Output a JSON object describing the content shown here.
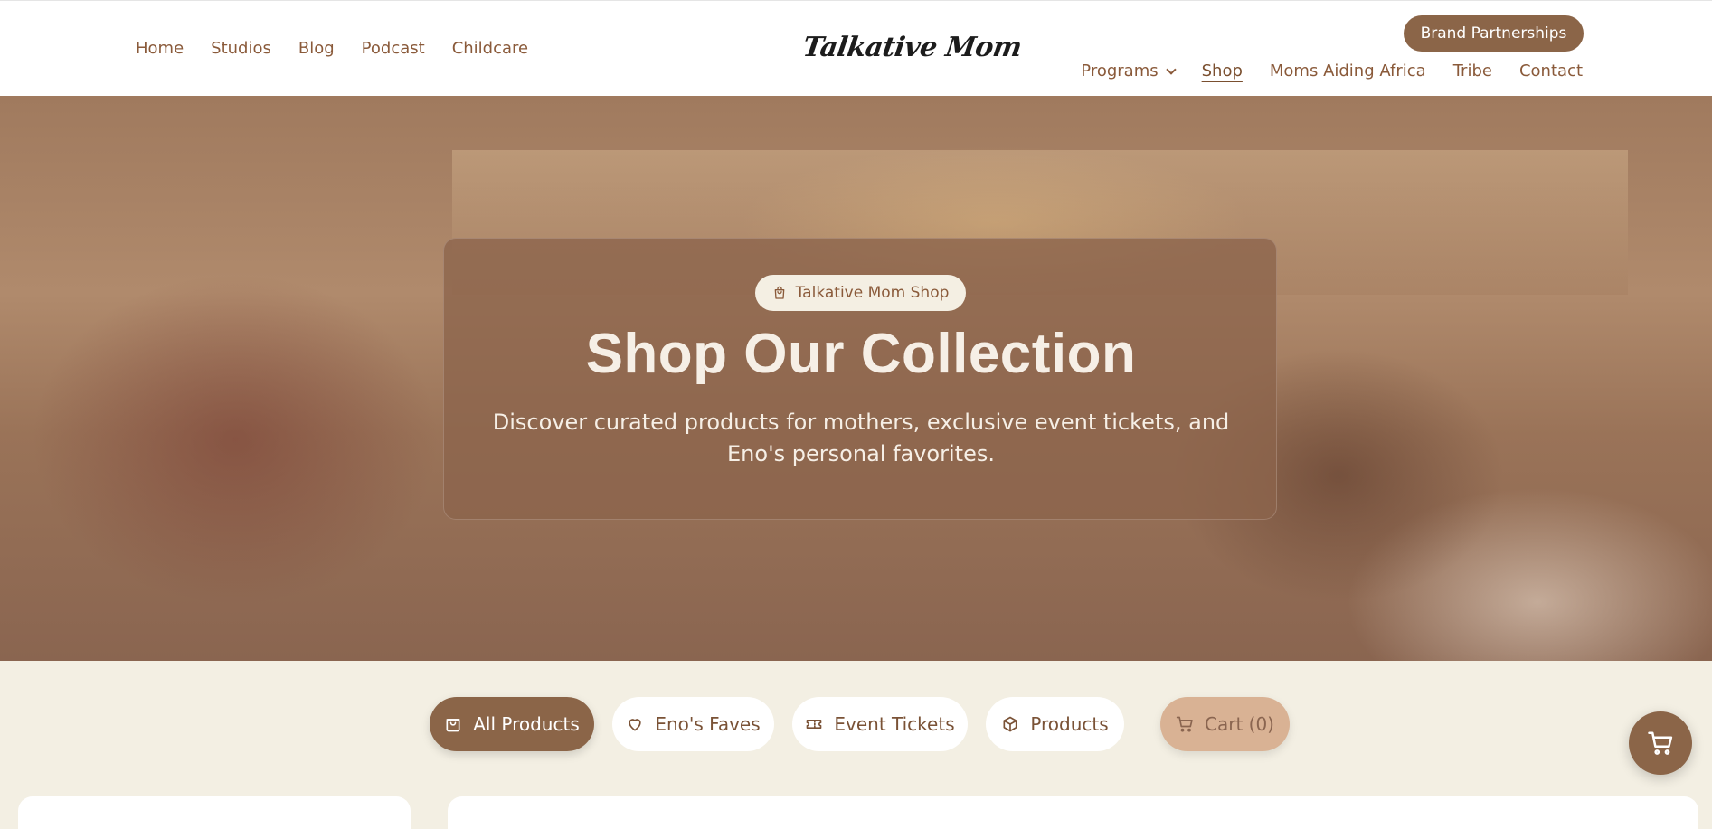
{
  "header": {
    "logo": "Talkative Mom",
    "nav_left": [
      "Home",
      "Studios",
      "Blog",
      "Podcast",
      "Childcare"
    ],
    "brand_button": "Brand Partnerships",
    "nav_right": {
      "programs": "Programs",
      "shop": "Shop",
      "moms_aiding_africa": "Moms Aiding Africa",
      "tribe": "Tribe",
      "contact": "Contact"
    },
    "active_item": "Shop"
  },
  "hero": {
    "badge": "Talkative Mom Shop",
    "title": "Shop Our Collection",
    "subtitle": "Discover curated products for mothers, exclusive event tickets, and Eno's personal favorites."
  },
  "tabs": {
    "all_products": "All Products",
    "enos_faves": "Eno's Faves",
    "event_tickets": "Event Tickets",
    "products": "Products",
    "cart": "Cart (0)"
  },
  "colors": {
    "accent": "#8b6548",
    "background": "#f3efe3",
    "text": "#7a5236",
    "cart_tab": "#d9b294"
  },
  "icons": {
    "badge": "shopping-bag-icon",
    "all_products": "shopping-bag-icon",
    "enos_faves": "heart-icon",
    "event_tickets": "ticket-icon",
    "products": "package-icon",
    "cart": "cart-icon",
    "floating_cart": "cart-icon",
    "programs": "chevron-down-icon"
  }
}
